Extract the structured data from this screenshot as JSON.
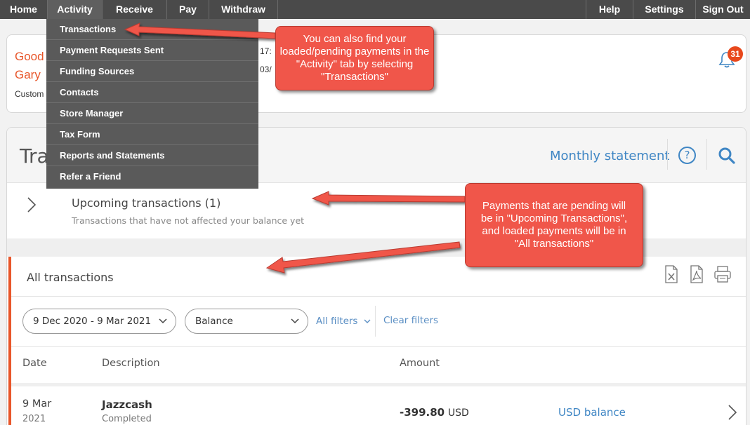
{
  "topnav": {
    "items": [
      "Home",
      "Activity",
      "Receive",
      "Pay",
      "Withdraw"
    ],
    "right": [
      "Help",
      "Settings",
      "Sign Out"
    ]
  },
  "account": {
    "greeting_line1": "Good",
    "greeting_line2": "Gary",
    "type_partial": "Custom",
    "time_partial": "17:",
    "date_partial": "03/",
    "notification_count": "31"
  },
  "activity_menu": {
    "items": [
      "Transactions",
      "Payment Requests Sent",
      "Funding Sources",
      "Contacts",
      "Store Manager",
      "Tax Form",
      "Reports and Statements",
      "Refer a Friend"
    ]
  },
  "transactions": {
    "title_partial": "Tra",
    "monthly_statement": "Monthly statement",
    "help_glyph": "?",
    "upcoming_title": "Upcoming transactions (1)",
    "upcoming_subtitle": "Transactions that have not affected your balance yet",
    "all_title": "All transactions",
    "date_range": "9 Dec 2020 - 9 Mar 2021",
    "balance_filter": "Balance",
    "all_filters": "All filters",
    "clear_filters": "Clear filters",
    "columns": [
      "Date",
      "Description",
      "Amount"
    ],
    "rows": [
      {
        "day": "9 Mar",
        "year": "2021",
        "description": "Jazzcash",
        "status": "Completed",
        "amount": "-399.80",
        "currency": "USD",
        "account": "USD balance"
      }
    ]
  },
  "annotations": {
    "callout1": "You can also find your loaded/pending payments in the \"Activity\" tab by selecting \"Transactions\"",
    "callout2": "Payments that are pending will be in \"Upcoming Transactions\", and loaded payments will be in \"All transactions\""
  },
  "colors": {
    "accent": "#e8562a",
    "link": "#3f86c4",
    "nav": "#4a4a4a",
    "callout": "#f0564a"
  }
}
